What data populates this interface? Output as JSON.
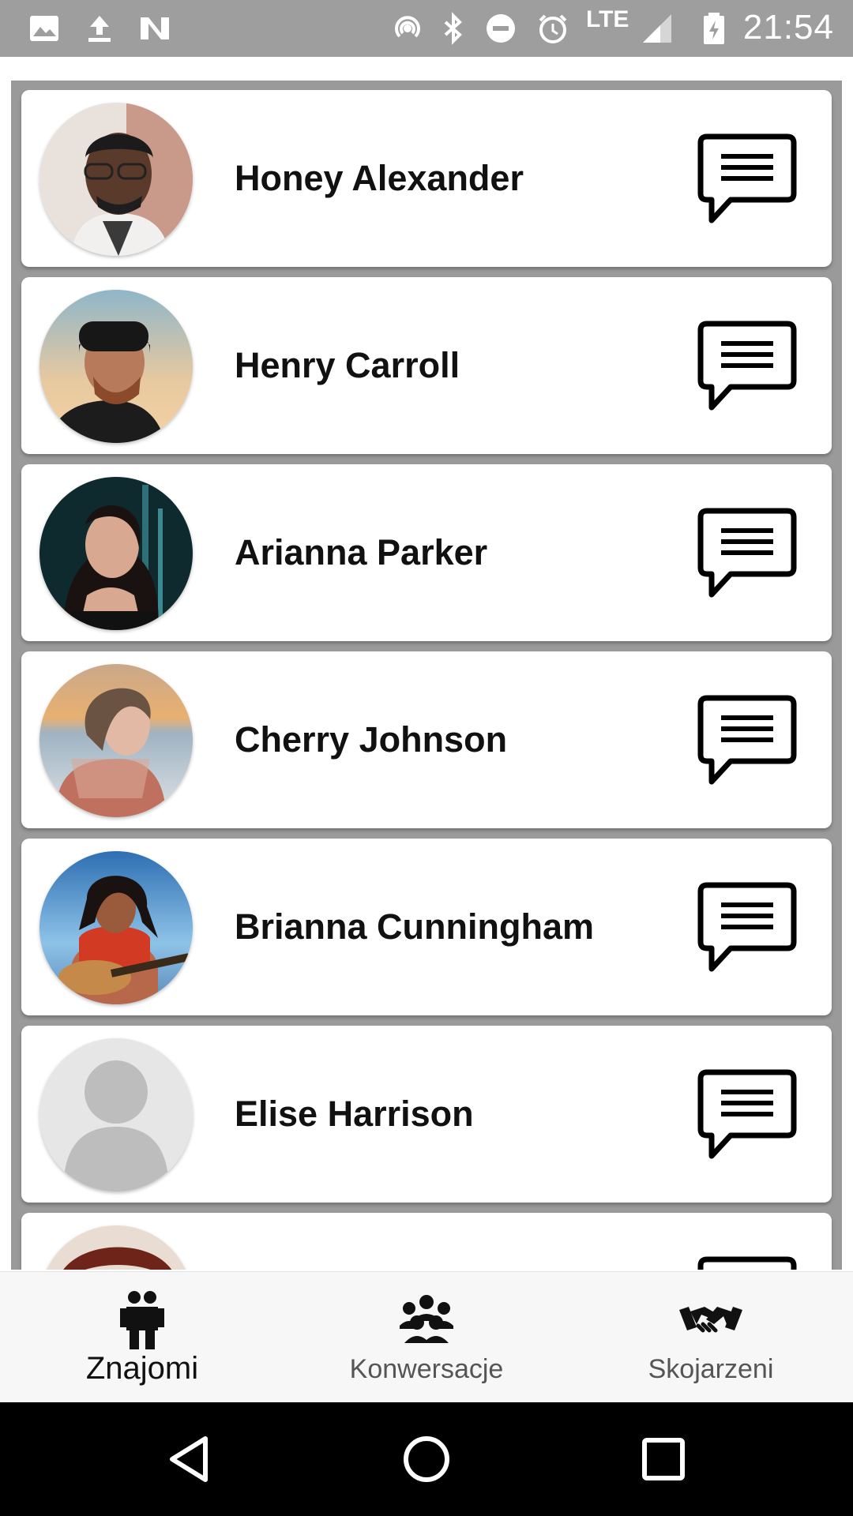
{
  "status_bar": {
    "time": "21:54",
    "network": "LTE",
    "left_icons": [
      "image-icon",
      "upload-icon",
      "n-app-icon"
    ],
    "right_icons": [
      "hotspot-icon",
      "bluetooth-icon",
      "do-not-disturb-icon",
      "alarm-icon",
      "signal-icon",
      "battery-charging-icon"
    ]
  },
  "friends": [
    {
      "name": "Honey Alexander",
      "avatar": "photo-man-glasses"
    },
    {
      "name": "Henry Carroll",
      "avatar": "photo-man-beanie"
    },
    {
      "name": "Arianna Parker",
      "avatar": "photo-woman-dark-hair"
    },
    {
      "name": "Cherry Johnson",
      "avatar": "photo-woman-sunset"
    },
    {
      "name": "Brianna Cunningham",
      "avatar": "photo-woman-guitar"
    },
    {
      "name": "Elise Harrison",
      "avatar": "placeholder-avatar"
    },
    {
      "name": "",
      "avatar": "photo-partial"
    }
  ],
  "bottom_nav": {
    "items": [
      {
        "label": "Znajomi",
        "icon": "friends-icon",
        "active": true
      },
      {
        "label": "Konwersacje",
        "icon": "group-icon",
        "active": false
      },
      {
        "label": "Skojarzeni",
        "icon": "handshake-icon",
        "active": false
      }
    ]
  },
  "system_nav": {
    "buttons": [
      "back-icon",
      "home-icon",
      "recents-icon"
    ]
  },
  "colors": {
    "status_bar": "#9e9e9e",
    "list_background": "#9a9a9a",
    "card": "#ffffff",
    "nav_background": "#f7f7f7",
    "active_label": "#111111",
    "inactive_label": "#555555"
  }
}
